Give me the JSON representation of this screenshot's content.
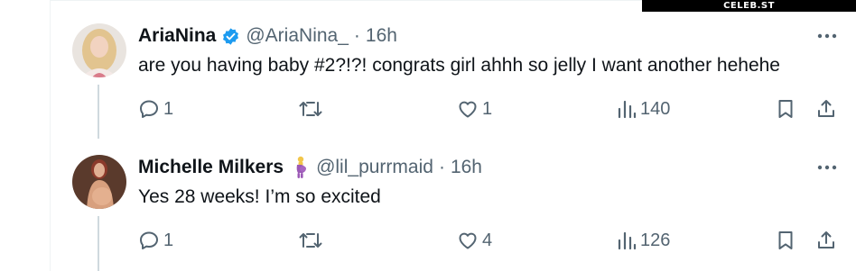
{
  "watermark": "CELEB.ST",
  "replies": [
    {
      "display_name": "AriaNina",
      "handle": "@AriaNina_",
      "separator": "·",
      "time": "16h",
      "text": "are you having baby #2?!?! congrats girl ahhh so jelly I want another hehehe",
      "reply_count": "1",
      "like_count": "1",
      "view_count": "140",
      "badge": "verified-badge-icon"
    },
    {
      "display_name": "Michelle Milkers",
      "handle": "@lil_purrmaid",
      "separator": "·",
      "time": "16h",
      "text": "Yes 28 weeks! I’m so excited",
      "reply_count": "1",
      "like_count": "4",
      "view_count": "126",
      "badge": "pregnant-person-emoji"
    }
  ],
  "colors": {
    "text": "#0f1419",
    "secondary": "#536471",
    "verified": "#1d9bf0",
    "thread_line": "#cfd9de"
  }
}
